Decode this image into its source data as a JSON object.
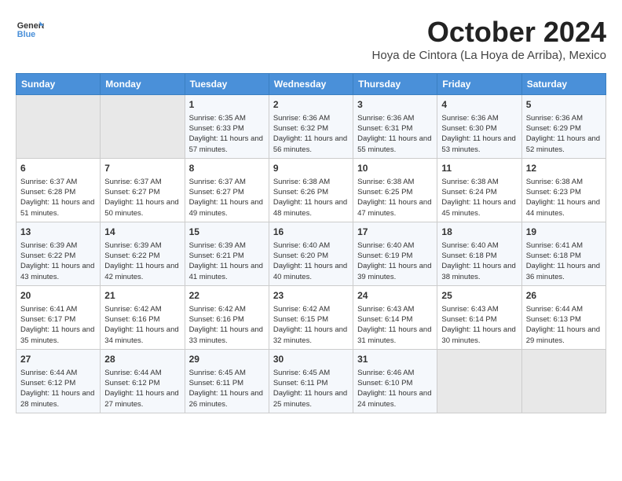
{
  "header": {
    "logo_line1": "General",
    "logo_line2": "Blue",
    "month_title": "October 2024",
    "location": "Hoya de Cintora (La Hoya de Arriba), Mexico"
  },
  "weekdays": [
    "Sunday",
    "Monday",
    "Tuesday",
    "Wednesday",
    "Thursday",
    "Friday",
    "Saturday"
  ],
  "weeks": [
    [
      {
        "day": "",
        "empty": true
      },
      {
        "day": "",
        "empty": true
      },
      {
        "day": "1",
        "sunrise": "6:35 AM",
        "sunset": "6:33 PM",
        "daylight": "11 hours and 57 minutes."
      },
      {
        "day": "2",
        "sunrise": "6:36 AM",
        "sunset": "6:32 PM",
        "daylight": "11 hours and 56 minutes."
      },
      {
        "day": "3",
        "sunrise": "6:36 AM",
        "sunset": "6:31 PM",
        "daylight": "11 hours and 55 minutes."
      },
      {
        "day": "4",
        "sunrise": "6:36 AM",
        "sunset": "6:30 PM",
        "daylight": "11 hours and 53 minutes."
      },
      {
        "day": "5",
        "sunrise": "6:36 AM",
        "sunset": "6:29 PM",
        "daylight": "11 hours and 52 minutes."
      }
    ],
    [
      {
        "day": "6",
        "sunrise": "6:37 AM",
        "sunset": "6:28 PM",
        "daylight": "11 hours and 51 minutes."
      },
      {
        "day": "7",
        "sunrise": "6:37 AM",
        "sunset": "6:27 PM",
        "daylight": "11 hours and 50 minutes."
      },
      {
        "day": "8",
        "sunrise": "6:37 AM",
        "sunset": "6:27 PM",
        "daylight": "11 hours and 49 minutes."
      },
      {
        "day": "9",
        "sunrise": "6:38 AM",
        "sunset": "6:26 PM",
        "daylight": "11 hours and 48 minutes."
      },
      {
        "day": "10",
        "sunrise": "6:38 AM",
        "sunset": "6:25 PM",
        "daylight": "11 hours and 47 minutes."
      },
      {
        "day": "11",
        "sunrise": "6:38 AM",
        "sunset": "6:24 PM",
        "daylight": "11 hours and 45 minutes."
      },
      {
        "day": "12",
        "sunrise": "6:38 AM",
        "sunset": "6:23 PM",
        "daylight": "11 hours and 44 minutes."
      }
    ],
    [
      {
        "day": "13",
        "sunrise": "6:39 AM",
        "sunset": "6:22 PM",
        "daylight": "11 hours and 43 minutes."
      },
      {
        "day": "14",
        "sunrise": "6:39 AM",
        "sunset": "6:22 PM",
        "daylight": "11 hours and 42 minutes."
      },
      {
        "day": "15",
        "sunrise": "6:39 AM",
        "sunset": "6:21 PM",
        "daylight": "11 hours and 41 minutes."
      },
      {
        "day": "16",
        "sunrise": "6:40 AM",
        "sunset": "6:20 PM",
        "daylight": "11 hours and 40 minutes."
      },
      {
        "day": "17",
        "sunrise": "6:40 AM",
        "sunset": "6:19 PM",
        "daylight": "11 hours and 39 minutes."
      },
      {
        "day": "18",
        "sunrise": "6:40 AM",
        "sunset": "6:18 PM",
        "daylight": "11 hours and 38 minutes."
      },
      {
        "day": "19",
        "sunrise": "6:41 AM",
        "sunset": "6:18 PM",
        "daylight": "11 hours and 36 minutes."
      }
    ],
    [
      {
        "day": "20",
        "sunrise": "6:41 AM",
        "sunset": "6:17 PM",
        "daylight": "11 hours and 35 minutes."
      },
      {
        "day": "21",
        "sunrise": "6:42 AM",
        "sunset": "6:16 PM",
        "daylight": "11 hours and 34 minutes."
      },
      {
        "day": "22",
        "sunrise": "6:42 AM",
        "sunset": "6:16 PM",
        "daylight": "11 hours and 33 minutes."
      },
      {
        "day": "23",
        "sunrise": "6:42 AM",
        "sunset": "6:15 PM",
        "daylight": "11 hours and 32 minutes."
      },
      {
        "day": "24",
        "sunrise": "6:43 AM",
        "sunset": "6:14 PM",
        "daylight": "11 hours and 31 minutes."
      },
      {
        "day": "25",
        "sunrise": "6:43 AM",
        "sunset": "6:14 PM",
        "daylight": "11 hours and 30 minutes."
      },
      {
        "day": "26",
        "sunrise": "6:44 AM",
        "sunset": "6:13 PM",
        "daylight": "11 hours and 29 minutes."
      }
    ],
    [
      {
        "day": "27",
        "sunrise": "6:44 AM",
        "sunset": "6:12 PM",
        "daylight": "11 hours and 28 minutes."
      },
      {
        "day": "28",
        "sunrise": "6:44 AM",
        "sunset": "6:12 PM",
        "daylight": "11 hours and 27 minutes."
      },
      {
        "day": "29",
        "sunrise": "6:45 AM",
        "sunset": "6:11 PM",
        "daylight": "11 hours and 26 minutes."
      },
      {
        "day": "30",
        "sunrise": "6:45 AM",
        "sunset": "6:11 PM",
        "daylight": "11 hours and 25 minutes."
      },
      {
        "day": "31",
        "sunrise": "6:46 AM",
        "sunset": "6:10 PM",
        "daylight": "11 hours and 24 minutes."
      },
      {
        "day": "",
        "empty": true
      },
      {
        "day": "",
        "empty": true
      }
    ]
  ],
  "labels": {
    "sunrise_prefix": "Sunrise: ",
    "sunset_prefix": "Sunset: ",
    "daylight_prefix": "Daylight: "
  }
}
